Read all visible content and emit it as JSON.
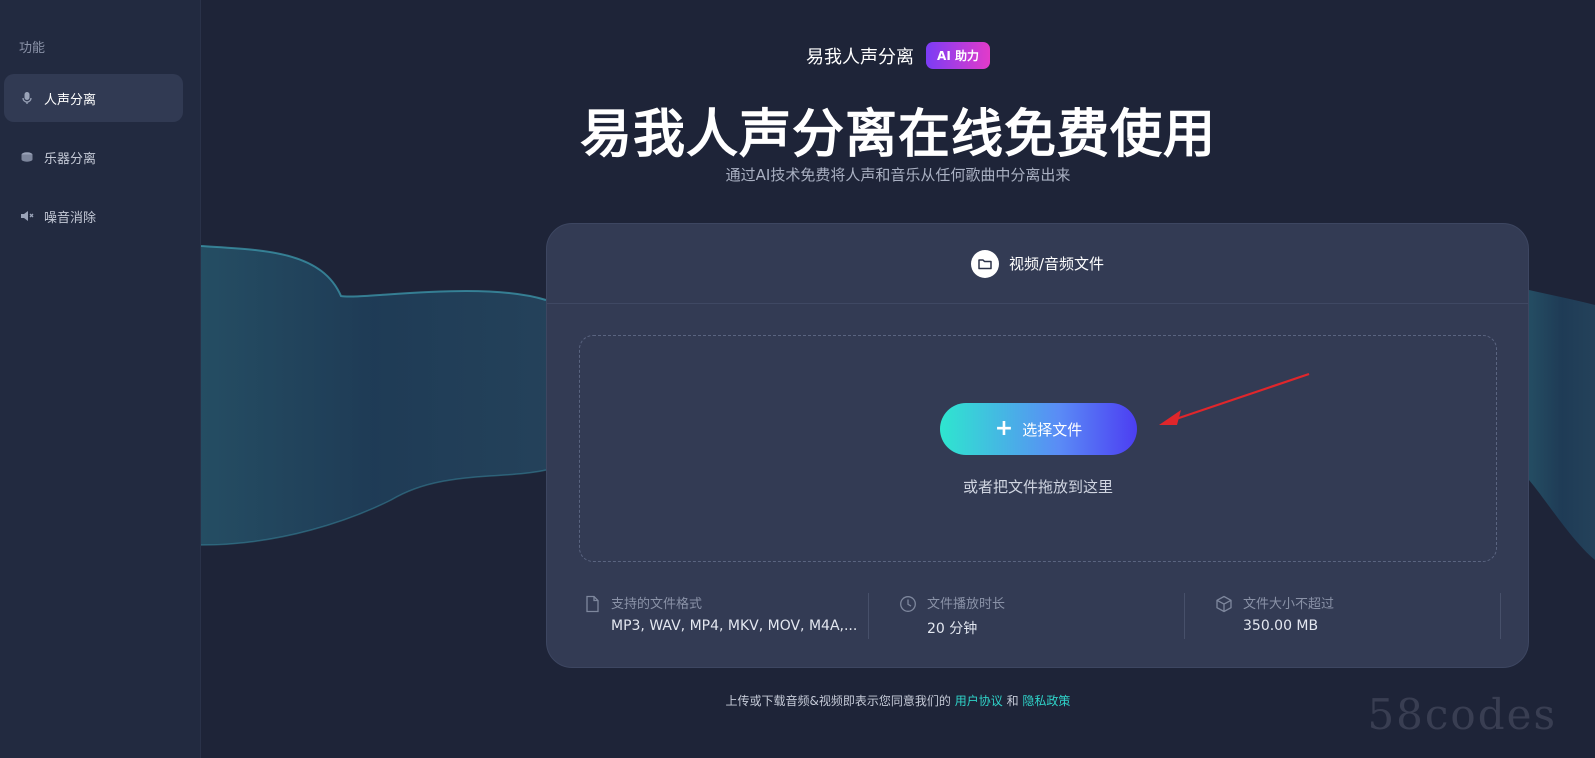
{
  "sidebar": {
    "heading": "功能",
    "items": [
      {
        "label": "人声分离",
        "icon": "microphone-icon",
        "active": true
      },
      {
        "label": "乐器分离",
        "icon": "drum-icon",
        "active": false
      },
      {
        "label": "噪音消除",
        "icon": "speaker-mute-icon",
        "active": false
      }
    ]
  },
  "header": {
    "brand": "易我人声分离",
    "badge": "AI 助力",
    "title": "易我人声分离在线免费使用",
    "subtitle": "通过AI技术免费将人声和音乐从任何歌曲中分离出来"
  },
  "card": {
    "tab_label": "视频/音频文件",
    "choose_button": "选择文件",
    "drop_hint": "或者把文件拖放到这里",
    "info": [
      {
        "label": "支持的文件格式",
        "value": "MP3, WAV, MP4, MKV, MOV, M4A,...",
        "icon": "file-icon"
      },
      {
        "label": "文件播放时长",
        "value": "20 分钟",
        "icon": "clock-icon"
      },
      {
        "label": "文件大小不超过",
        "value": "350.00 MB",
        "icon": "cube-icon"
      }
    ]
  },
  "footer": {
    "prefix": "上传或下载音频&视频即表示您同意我们的",
    "terms": "用户协议",
    "and": "和",
    "privacy": "隐私政策"
  },
  "watermark": "58codes",
  "colors": {
    "background": "#1e2438",
    "sidebar": "#222a40",
    "card": "#343c55",
    "accent_teal": "#2fd3c9",
    "button_gradient_start": "#2ee6cf",
    "button_gradient_end": "#4c3ef2",
    "badge_gradient_start": "#7b3cf5",
    "badge_gradient_end": "#e23bc9",
    "annotation_arrow": "#e0262b"
  }
}
